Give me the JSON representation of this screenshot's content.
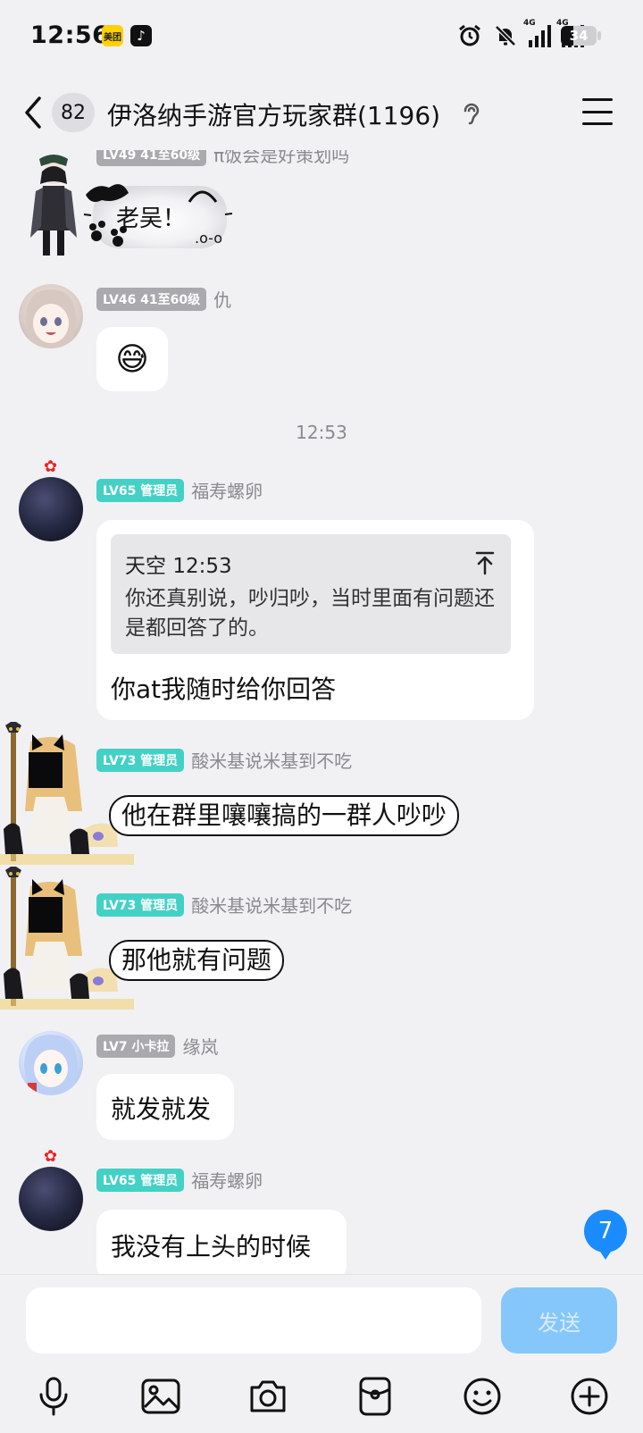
{
  "status_bar": {
    "time": "12:56",
    "apps": [
      "美团",
      "♪"
    ],
    "network_tags": [
      "4G",
      "4G"
    ],
    "battery_level": "34",
    "battery_fraction": 0.34
  },
  "header": {
    "unread_count": "82",
    "title": "伊洛纳手游官方玩家群(1196)"
  },
  "messages": [
    {
      "level": "LV49 41至60级",
      "nickname": "π饭会是好策划吗",
      "content_text": "老吴！",
      "content_type": "sticker"
    },
    {
      "level": "LV46 41至60级",
      "nickname": "仇",
      "emoji": "😅"
    },
    {
      "time_separator": "12:53"
    },
    {
      "level": "LV65 管理员",
      "nickname": "福寿螺卵",
      "reply": {
        "author": "天空",
        "time": "12:53",
        "text": "你还真别说，吵归吵，当时里面有问题还是都回答了的。"
      },
      "text": "你at我随时给你回答"
    },
    {
      "level": "LV73 管理员",
      "nickname": "酸米基说米基到不吃",
      "text": "他在群里嚷嚷搞的一群人吵吵"
    },
    {
      "level": "LV73 管理员",
      "nickname": "酸米基说米基到不吃",
      "text": "那他就有问题"
    },
    {
      "level": "LV7 小卡拉",
      "nickname": "缘岚",
      "text": "就发就发"
    },
    {
      "level": "LV65 管理员",
      "nickname": "福寿螺卵",
      "text": "我没有上头的时候"
    }
  ],
  "new_message_count": "7",
  "input": {
    "placeholder": "",
    "send_label": "发送"
  },
  "toolbar_icons": [
    "microphone-icon",
    "image-icon",
    "camera-icon",
    "red-packet-icon",
    "emoji-icon",
    "plus-icon"
  ],
  "colors": {
    "background": "#f1f1f4",
    "admin_badge": "#43d1c6",
    "level_badge": "#a9a9ae",
    "send_button": "#86c7fb",
    "new_count_badge": "#1a8cff"
  }
}
